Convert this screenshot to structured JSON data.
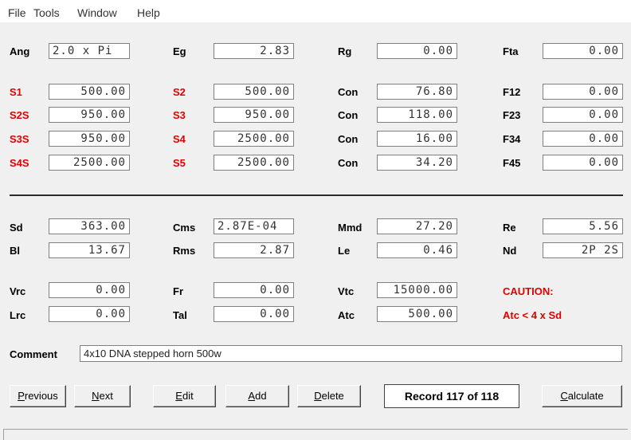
{
  "menu": [
    "File",
    "Tools",
    "Window",
    "Help"
  ],
  "top_row": [
    {
      "label": "Ang",
      "value": "2.0 x Pi"
    },
    {
      "label": "Eg",
      "value": "2.83"
    },
    {
      "label": "Rg",
      "value": "0.00"
    },
    {
      "label": "Fta",
      "value": "0.00"
    }
  ],
  "sections": [
    {
      "s_label": "S1",
      "s_value": "500.00",
      "s2_label": "S2",
      "s2_value": "500.00",
      "con_label": "Con",
      "con_value": "76.80",
      "f_label": "F12",
      "f_value": "0.00"
    },
    {
      "s_label": "S2S",
      "s_value": "950.00",
      "s2_label": "S3",
      "s2_value": "950.00",
      "con_label": "Con",
      "con_value": "118.00",
      "f_label": "F23",
      "f_value": "0.00"
    },
    {
      "s_label": "S3S",
      "s_value": "950.00",
      "s2_label": "S4",
      "s2_value": "2500.00",
      "con_label": "Con",
      "con_value": "16.00",
      "f_label": "F34",
      "f_value": "0.00"
    },
    {
      "s_label": "S4S",
      "s_value": "2500.00",
      "s2_label": "S5",
      "s2_value": "2500.00",
      "con_label": "Con",
      "con_value": "34.20",
      "f_label": "F45",
      "f_value": "0.00"
    }
  ],
  "driver": {
    "sd": {
      "label": "Sd",
      "value": "363.00"
    },
    "cms": {
      "label": "Cms",
      "value": "2.87E-04"
    },
    "mmd": {
      "label": "Mmd",
      "value": "27.20"
    },
    "re": {
      "label": "Re",
      "value": "5.56"
    },
    "bl": {
      "label": "Bl",
      "value": "13.67"
    },
    "rms": {
      "label": "Rms",
      "value": "2.87"
    },
    "le": {
      "label": "Le",
      "value": "0.46"
    },
    "nd": {
      "label": "Nd",
      "value": "2P 2S"
    }
  },
  "chamber": {
    "vrc": {
      "label": "Vrc",
      "value": "0.00"
    },
    "fr": {
      "label": "Fr",
      "value": "0.00"
    },
    "vtc": {
      "label": "Vtc",
      "value": "15000.00"
    },
    "lrc": {
      "label": "Lrc",
      "value": "0.00"
    },
    "tal": {
      "label": "Tal",
      "value": "0.00"
    },
    "atc": {
      "label": "Atc",
      "value": "500.00"
    }
  },
  "caution": {
    "title": "CAUTION:",
    "message": "Atc < 4 x Sd"
  },
  "comment": {
    "label": "Comment",
    "value": "4x10 DNA stepped horn 500w"
  },
  "buttons": {
    "previous": {
      "u": "P",
      "rest": "revious"
    },
    "next": {
      "u": "N",
      "rest": "ext"
    },
    "edit": {
      "u": "E",
      "rest": "dit"
    },
    "add": {
      "u": "A",
      "rest": "dd"
    },
    "delete": {
      "u": "D",
      "rest": "elete"
    },
    "calculate": {
      "u": "C",
      "rest": "alculate"
    }
  },
  "record": "Record 117 of 118",
  "colors": {
    "warning": "#e00000",
    "background": "#f0f0f0"
  }
}
